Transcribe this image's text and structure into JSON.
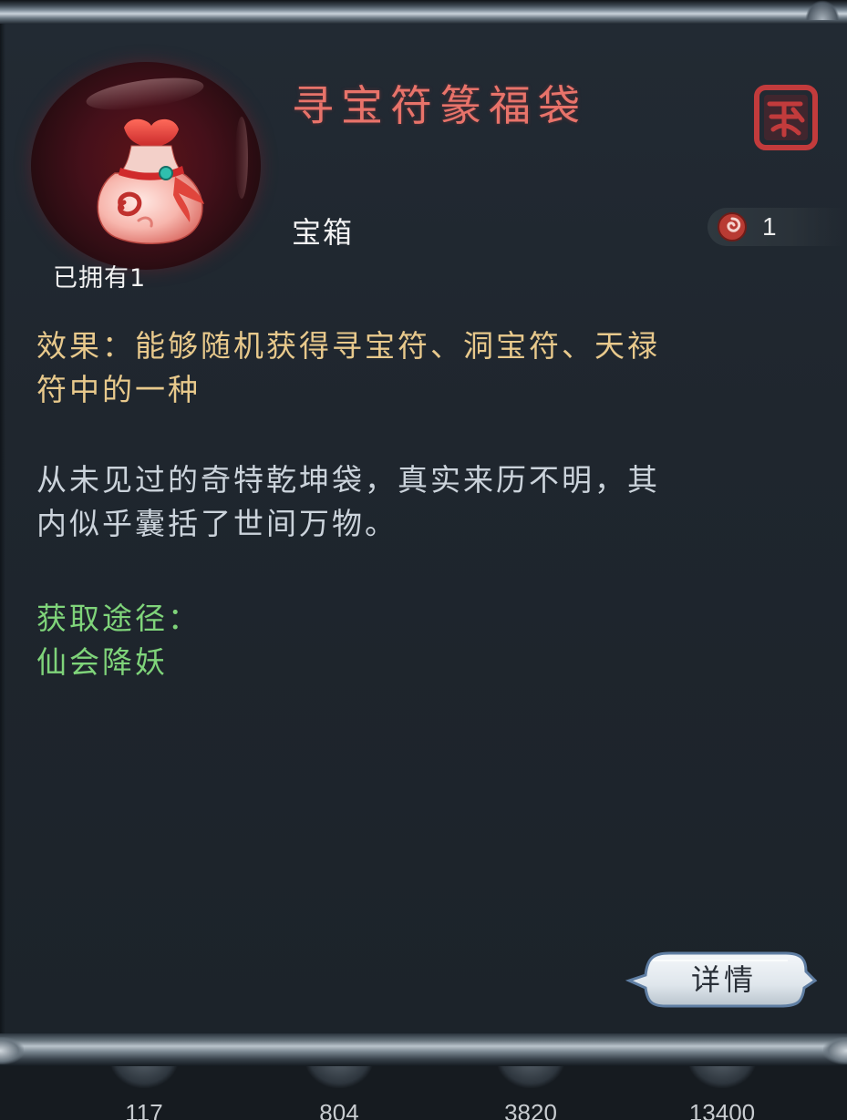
{
  "item": {
    "name": "寻宝符篆福袋",
    "type": "宝箱",
    "owned_text": "已拥有1",
    "count": "1",
    "effect_lines": [
      "效果：能够随机获得寻宝符、洞宝符、天禄",
      "符中的一种"
    ],
    "flavor_lines": [
      "从未见过的奇特乾坤袋，真实来历不明，其",
      "内似乎囊括了世间万物。"
    ],
    "source_label": "获取途径：",
    "source_value": "仙会降妖"
  },
  "actions": {
    "detail_label": "详情"
  },
  "background_numbers": [
    "117",
    "804",
    "3820",
    "13400"
  ],
  "icons": {
    "item_icon": "lucky-bag-icon",
    "seal": "seal-stamp-icon",
    "count": "swirl-token-icon"
  },
  "colors": {
    "title": "#e8736a",
    "effect": "#e8c98c",
    "flavor": "#cbd3db",
    "source": "#7fd47a",
    "panel_bg": "#1f262e"
  }
}
